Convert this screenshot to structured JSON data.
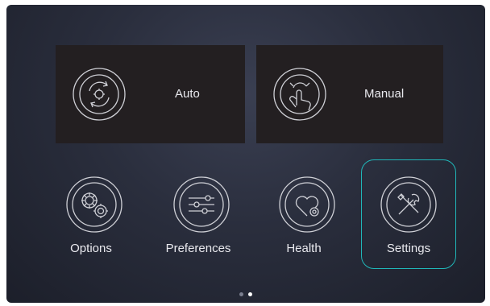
{
  "modes": {
    "auto": {
      "label": "Auto",
      "icon": "auto-cycle-icon"
    },
    "manual": {
      "label": "Manual",
      "icon": "hand-touch-icon"
    }
  },
  "menu": [
    {
      "label": "Options",
      "icon": "gears-icon"
    },
    {
      "label": "Preferences",
      "icon": "sliders-icon"
    },
    {
      "label": "Health",
      "icon": "heart-gear-icon"
    },
    {
      "label": "Settings",
      "icon": "tools-icon",
      "selected": true
    }
  ],
  "pager": {
    "pages": 2,
    "active": 2
  },
  "colors": {
    "selected_border": "#20b7b9",
    "card_background": "#231f21",
    "text": "#e9e9ee",
    "dot_active": "#ffffff",
    "dot_inactive": "#7a7f8f"
  }
}
